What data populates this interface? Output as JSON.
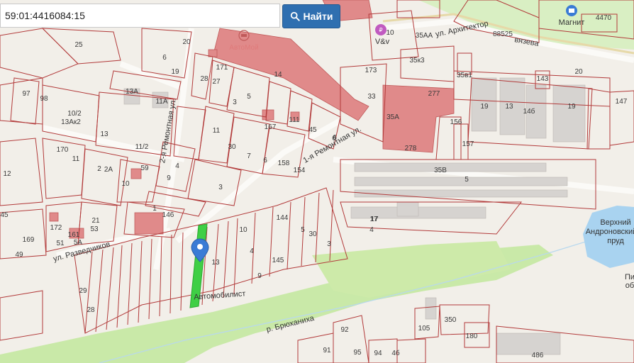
{
  "search": {
    "value": "59:01:4416084:15",
    "button_label": "Найти"
  },
  "colors": {
    "accent": "#2f6fb0",
    "parcel": "#b23a3a",
    "building": "#e08a8a",
    "highlight": "#3fcf45",
    "water": "#a9d3f0",
    "green": "#c9e9a8",
    "pin": "#3a7bd5"
  },
  "icons": {
    "search_icon": "search-icon",
    "pin": "map-pin-icon"
  },
  "streets": {
    "architektor": "ул. Архитектор",
    "vyazev": "вязева",
    "remontnaya_1": "1-я Ремонтная ул.",
    "remontnaya_2": "2-я Ремонтная ул.",
    "razvedchikov": "ул. Разведчиков",
    "bryukhanikha": "р. Брюханиха",
    "pond_1": "Верхний",
    "pond_2": "Андроновский",
    "pond_3": "пруд",
    "side_1": "Пи",
    "side_2": "об"
  },
  "pois": {
    "avtomoi": "АвтоМой",
    "vv": "V&v",
    "magnit": "Магнит",
    "avtomobilist": "Автомобилист"
  },
  "parcel_numbers": [
    "25",
    "20",
    "6",
    "19",
    "171",
    "28",
    "27",
    "14",
    "173",
    "10",
    "35АА",
    "35к3",
    "35в1",
    "20",
    "277",
    "143",
    "97",
    "98",
    "10/2",
    "13Ак2",
    "13А",
    "11А",
    "13",
    "11",
    "5",
    "3",
    "167",
    "111",
    "45",
    "6",
    "33",
    "35А",
    "156",
    "157",
    "19",
    "13",
    "14б",
    "19",
    "147",
    "170",
    "11",
    "11/2",
    "30",
    "7",
    "6",
    "158",
    "154",
    "35В",
    "5",
    "2",
    "2А",
    "10",
    "4",
    "9",
    "3",
    "12",
    "59",
    "1",
    "146",
    "17",
    "4",
    "45",
    "172",
    "161",
    "5А",
    "21",
    "53",
    "51",
    "169",
    "49",
    "144",
    "5",
    "30",
    "3",
    "10",
    "4",
    "9",
    "145",
    "13",
    "29",
    "28",
    "105",
    "350",
    "180",
    "92",
    "91",
    "95",
    "94",
    "4б",
    "486",
    "4470",
    "88525",
    "278",
    "17",
    "6"
  ]
}
